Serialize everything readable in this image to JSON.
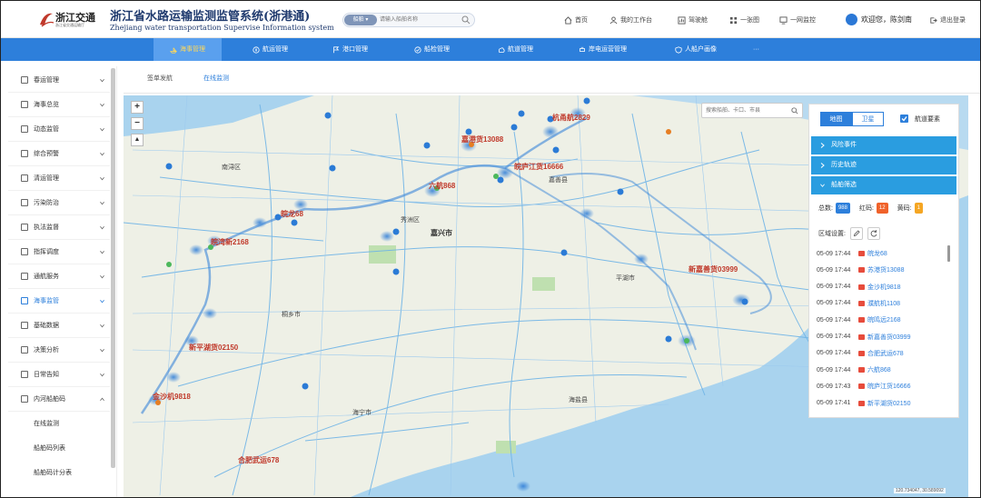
{
  "header": {
    "logo_text": "浙江交通",
    "logo_sub": "浙江省交通运输厅",
    "title": "浙江省水路运输监测监管系统(浙港通)",
    "subtitle": "Zhejiang water transportation Supervise Information system",
    "search_type": "船舶",
    "search_placeholder": "请输入船舶名称",
    "links": [
      {
        "label": "首页",
        "icon": "home-icon"
      },
      {
        "label": "我的工作台",
        "icon": "user-icon"
      },
      {
        "label": "驾驶舱",
        "icon": "dashboard-icon"
      },
      {
        "label": "一张图",
        "icon": "grid-icon"
      },
      {
        "label": "一网监控",
        "icon": "monitor-icon"
      }
    ],
    "welcome": "欢迎您，陈剑南",
    "logout": "退出登录"
  },
  "nav": [
    {
      "label": "海事管理",
      "active": true
    },
    {
      "label": "航运管理",
      "active": false
    },
    {
      "label": "港口管理",
      "active": false
    },
    {
      "label": "船检管理",
      "active": false
    },
    {
      "label": "航道管理",
      "active": false
    },
    {
      "label": "岸电运营管理",
      "active": false
    },
    {
      "label": "人船户画像",
      "active": false
    },
    {
      "label": "···",
      "active": false
    }
  ],
  "sidebar": {
    "items": [
      {
        "label": "春运管理",
        "expanded": false,
        "active": false
      },
      {
        "label": "海事总览",
        "expanded": false,
        "active": false
      },
      {
        "label": "动态监管",
        "expanded": false,
        "active": false
      },
      {
        "label": "综合预警",
        "expanded": false,
        "active": false
      },
      {
        "label": "清运管理",
        "expanded": false,
        "active": false
      },
      {
        "label": "污染防治",
        "expanded": false,
        "active": false
      },
      {
        "label": "执法监督",
        "expanded": false,
        "active": false
      },
      {
        "label": "指挥调度",
        "expanded": false,
        "active": false
      },
      {
        "label": "通航服务",
        "expanded": false,
        "active": false
      },
      {
        "label": "海事监管",
        "expanded": false,
        "active": true
      },
      {
        "label": "基础数据",
        "expanded": false,
        "active": false
      },
      {
        "label": "决策分析",
        "expanded": false,
        "active": false
      },
      {
        "label": "日常告知",
        "expanded": false,
        "active": false
      },
      {
        "label": "内河船舶码",
        "expanded": true,
        "active": false
      }
    ],
    "sub_items": [
      "在线监测",
      "船舶码列表",
      "船舶码计分表"
    ]
  },
  "tabs": [
    {
      "label": "签单发航",
      "active": false
    },
    {
      "label": "在线监测",
      "active": true
    }
  ],
  "map": {
    "search_placeholder": "搜索船舶、卡口、市县",
    "places": [
      {
        "name": "南浔区",
        "size": "small"
      },
      {
        "name": "秀洲区",
        "size": "small"
      },
      {
        "name": "嘉兴市",
        "size": "big"
      },
      {
        "name": "嘉善县",
        "size": "small"
      },
      {
        "name": "平湖市",
        "size": "small"
      },
      {
        "name": "桐乡市",
        "size": "small"
      },
      {
        "name": "海宁市",
        "size": "small"
      },
      {
        "name": "海盐县",
        "size": "small"
      }
    ],
    "ships": [
      "杭甬航2829",
      "嘉港货13088",
      "皖庐江货16666",
      "六航868",
      "皖龙68",
      "皖湾新2168",
      "新嘉善货03999",
      "新平湖货02150",
      "金沙机9818",
      "合肥武运678"
    ],
    "coord": "120.734047, 30.589092"
  },
  "panel": {
    "map_btn": "地图",
    "sat_btn": "卫星",
    "layer_check": "航道要素",
    "sections": [
      "风险事件",
      "历史轨迹",
      "船舶筛选"
    ],
    "stats": {
      "total_label": "总数:",
      "total": "988",
      "red_label": "红码:",
      "red": "12",
      "yellow_label": "黄码:",
      "yellow": "1"
    },
    "region_label": "区域设置:",
    "list": [
      {
        "time": "05-09 17:44",
        "name": "皖龙68"
      },
      {
        "time": "05-09 17:44",
        "name": "苏港货13088"
      },
      {
        "time": "05-09 17:44",
        "name": "金沙机9818"
      },
      {
        "time": "05-09 17:44",
        "name": "濮航机1108"
      },
      {
        "time": "05-09 17:44",
        "name": "皖鸣远2168"
      },
      {
        "time": "05-09 17:44",
        "name": "新嘉善货03999"
      },
      {
        "time": "05-09 17:44",
        "name": "合肥武运678"
      },
      {
        "time": "05-09 17:44",
        "name": "六航868"
      },
      {
        "time": "05-09 17:43",
        "name": "皖庐江货16666"
      },
      {
        "time": "05-09 17:41",
        "name": "新平湖货02150"
      }
    ]
  },
  "colors": {
    "primary": "#2d7fdb",
    "accordion": "#2a9de0",
    "red_badge": "#f0622a",
    "yellow_badge": "#f5a623",
    "total_badge": "#2d7fdb",
    "ship_label": "#c0392b"
  }
}
